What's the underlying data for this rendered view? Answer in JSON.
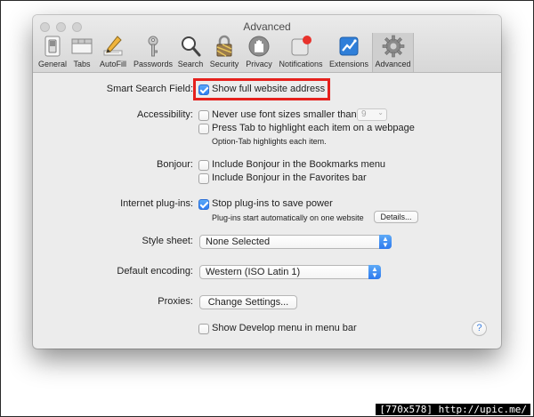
{
  "window": {
    "title": "Advanced"
  },
  "toolbar": {
    "items": [
      {
        "label": "General",
        "icon": "general-switch-icon"
      },
      {
        "label": "Tabs",
        "icon": "tabs-icon"
      },
      {
        "label": "AutoFill",
        "icon": "pencil-icon"
      },
      {
        "label": "Passwords",
        "icon": "key-icon"
      },
      {
        "label": "Search",
        "icon": "magnifier-icon"
      },
      {
        "label": "Security",
        "icon": "padlock-icon"
      },
      {
        "label": "Privacy",
        "icon": "hand-icon"
      },
      {
        "label": "Notifications",
        "icon": "notification-badge-icon"
      },
      {
        "label": "Extensions",
        "icon": "puzzle-icon"
      },
      {
        "label": "Advanced",
        "icon": "gear-icon"
      }
    ],
    "selected": "Advanced"
  },
  "settings": {
    "smart_search": {
      "label": "Smart Search Field:",
      "option": "Show full website address",
      "checked": true
    },
    "accessibility": {
      "label": "Accessibility:",
      "font_size_option": "Never use font sizes smaller than",
      "font_size_value": "9",
      "font_size_checked": false,
      "tab_option": "Press Tab to highlight each item on a webpage",
      "tab_checked": false,
      "tab_note": "Option-Tab highlights each item."
    },
    "bonjour": {
      "label": "Bonjour:",
      "bookmarks_option": "Include Bonjour in the Bookmarks menu",
      "bookmarks_checked": false,
      "favorites_option": "Include Bonjour in the Favorites bar",
      "favorites_checked": false
    },
    "plugins": {
      "label": "Internet plug-ins:",
      "option": "Stop plug-ins to save power",
      "checked": true,
      "note": "Plug-ins start automatically on one website",
      "details_button": "Details..."
    },
    "style_sheet": {
      "label": "Style sheet:",
      "value": "None Selected"
    },
    "encoding": {
      "label": "Default encoding:",
      "value": "Western (ISO Latin 1)"
    },
    "proxies": {
      "label": "Proxies:",
      "button": "Change Settings..."
    },
    "develop": {
      "option": "Show Develop menu in menu bar",
      "checked": false
    }
  },
  "help_glyph": "?",
  "watermark": "[770x578] http://upic.me/",
  "colors": {
    "highlight": "#e5211d",
    "accent": "#2f7ef2"
  }
}
